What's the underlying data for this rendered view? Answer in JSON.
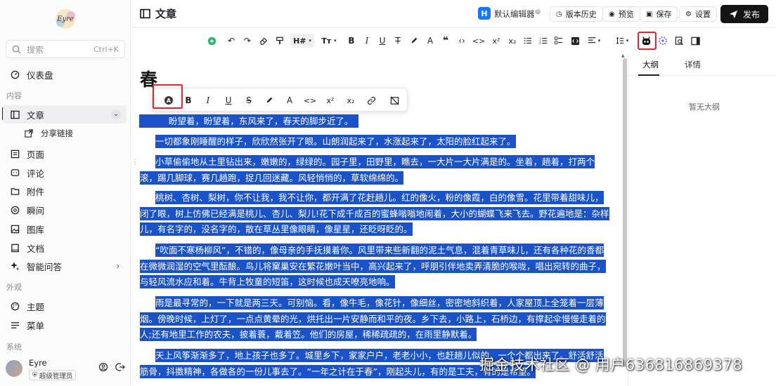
{
  "sidebar": {
    "search_placeholder": "搜索",
    "search_shortcut": "Ctrl+K",
    "dashboard": "仪表盘",
    "section_content": "内容",
    "articles": "文章",
    "share_link": "分享链接",
    "pages": "页面",
    "comments": "评论",
    "attachments": "附件",
    "moments": "瞬间",
    "gallery": "图库",
    "docs": "文档",
    "smart_qa": "智能问答",
    "section_appearance": "外观",
    "themes": "主题",
    "menus": "菜单",
    "section_system": "系统",
    "user_name": "Eyre",
    "user_role": "超级管理员"
  },
  "header": {
    "title": "文章",
    "editor_badge": "H",
    "editor_name": "默认编辑器",
    "history": "版本历史",
    "preview": "预览",
    "save": "保存",
    "settings": "设置",
    "publish": "发布"
  },
  "toolbar": {
    "heading": "H#",
    "font_size": "Tт"
  },
  "editor": {
    "title": "春",
    "paragraphs": [
      "盼望着，盼望着，东风来了，春天的脚步近了。",
      "一切都象刚睡醒的样子，欣欣然张开了眼。山朗润起来了，水涨起来了，太阳的脸红起来了。",
      "小草偷偷地从土里钻出来，嫩嫩的，绿绿的。园子里，田野里，瞧去，一大片一大片满是的。坐着，趟着，打两个滚，踢几脚球，赛几趟跑，捉几回迷藏。风轻悄悄的，草软绵绵的。",
      "桃树、杏树、梨树，你不让我，我不让你，都开满了花赶趟儿。红的像火，粉的像霞，白的像雪。花里带着甜味儿，闭了眼，树上仿佛已经满是桃儿、杏儿、梨儿!花下成千成百的蜜蜂嗡嗡地闹着，大小的蝴蝶飞来飞去。野花遍地是：杂样儿，有名字的，没名字的，散在草丛里像眼睛，像星星，还眨呀眨的。",
      "“吹面不寒杨柳风”，不错的，像母亲的手抚摸着你。风里带来些新翻的泥土气息，混着青草味儿，还有各种花的香都在微微润湿的空气里酝酿。鸟儿将窠巢安在繁花嫩叶当中，高兴起来了，呼朋引伴地卖弄清脆的喉咙，唱出宛转的曲子，与轻风流水应和着。牛背上牧童的短笛，这时候也成天嘹亮地响。",
      "雨是最寻常的，一下就是两三天。可别恼。看，像牛毛，像花针，像细丝，密密地斜织着，人家屋顶上全笼着一层薄烟。傍晚时候，上灯了，一点点黄晕的光，烘托出一片安静而和平的夜。乡下去，小路上，石桥边，有撑起伞慢慢走着的人;还有地里工作的农夫，披着蓑，戴着笠。他们的房屋，稀稀疏疏的，在雨里静默着。",
      "天上风筝渐渐多了，地上孩子也多了。城里乡下，家家户户，老老小小，也赶趟儿似的，一个个都出来了。舒活舒活筋骨，抖擞精神，各做各的一份儿事去了。“一年之计在于春”，刚起头儿，有的是工夫，有的是希望。"
    ]
  },
  "right_panel": {
    "tab_outline": "大纲",
    "tab_details": "详情",
    "empty_text": "暂无大纲"
  },
  "watermark": "掘金技术社区 @ 用户636816869378",
  "colors": {
    "selection": "#1a52c8",
    "highlight_border": "#e0262b",
    "publish_bg": "#141414",
    "editor_badge": "#1677ff"
  }
}
